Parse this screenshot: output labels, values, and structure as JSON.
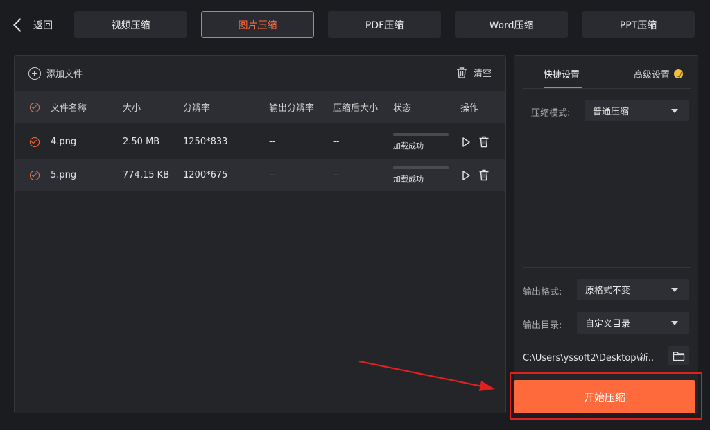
{
  "header": {
    "back_label": "返回",
    "tabs": [
      {
        "label": "视频压缩",
        "active": false
      },
      {
        "label": "图片压缩",
        "active": true
      },
      {
        "label": "PDF压缩",
        "active": false
      },
      {
        "label": "Word压缩",
        "active": false
      },
      {
        "label": "PPT压缩",
        "active": false
      }
    ]
  },
  "toolbar": {
    "add_file_label": "添加文件",
    "clear_label": "清空"
  },
  "table": {
    "columns": [
      "文件名称",
      "大小",
      "分辨率",
      "输出分辨率",
      "压缩后大小",
      "状态",
      "操作"
    ],
    "rows": [
      {
        "name": "4.png",
        "size": "2.50 MB",
        "resolution": "1250*833",
        "output_resolution": "--",
        "compressed_size": "--",
        "status": "加载成功",
        "progress": 1.0
      },
      {
        "name": "5.png",
        "size": "774.15 KB",
        "resolution": "1200*675",
        "output_resolution": "--",
        "compressed_size": "--",
        "status": "加载成功",
        "progress": 1.0
      }
    ]
  },
  "settings": {
    "tab_quick": "快捷设置",
    "tab_advanced": "高级设置",
    "compress_mode_label": "压缩模式:",
    "compress_mode_value": "普通压缩",
    "output_format_label": "输出格式:",
    "output_format_value": "原格式不变",
    "output_dir_label": "输出目录:",
    "output_dir_value": "自定义目录",
    "output_path": "C:\\Users\\yssoft2\\Desktop\\新..."
  },
  "start_button_label": "开始压缩",
  "colors": {
    "accent": "#ff6a3d",
    "highlight_red": "#e0201c",
    "background": "#1b1c20",
    "panel": "#242529"
  }
}
